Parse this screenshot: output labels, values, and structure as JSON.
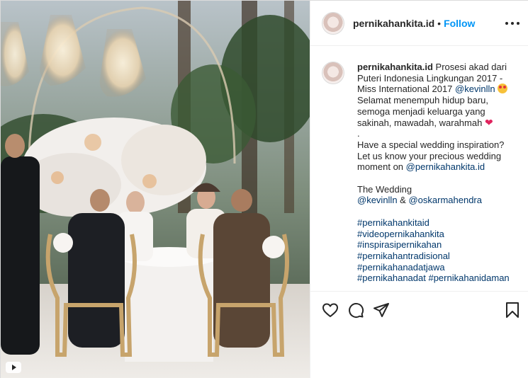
{
  "header": {
    "username": "pernikahankita.id",
    "separator": "•",
    "follow_label": "Follow",
    "more_icon": "more-horizontal-icon"
  },
  "caption": {
    "username": "pernikahankita.id",
    "text_1": " Prosesi akad dari Puteri Indonesia Lingkungan 2017 - Miss International 2017 ",
    "mention_1": "@kevinlln",
    "emoji_1": "star-struck-emoji",
    "text_2": "Selamat menempuh hidup baru, semoga menjadi keluarga yang sakinah, mawadah, warahmah ",
    "emoji_2": "❤",
    "text_3": ".\nHave a special wedding inspiration? Let us know your precious wedding moment on ",
    "mention_2": "@pernikahankita.id",
    "text_4": "\n\nThe Wedding\n",
    "mention_3": "@kevinlln",
    "text_5": " & ",
    "mention_4": "@oskarmahendra",
    "hashtags": [
      "#pernikahankitaid",
      "#videopernikahankita",
      "#inspirasipernikahan",
      "#pernikahantradisional",
      "#pernikahanadatjawa",
      "#pernikahanadat #pernikahanidaman"
    ]
  },
  "actions": {
    "like_icon": "heart-icon",
    "comment_icon": "comment-icon",
    "share_icon": "share-icon",
    "save_icon": "bookmark-icon"
  },
  "media": {
    "video_icon": "video-camera-icon"
  }
}
